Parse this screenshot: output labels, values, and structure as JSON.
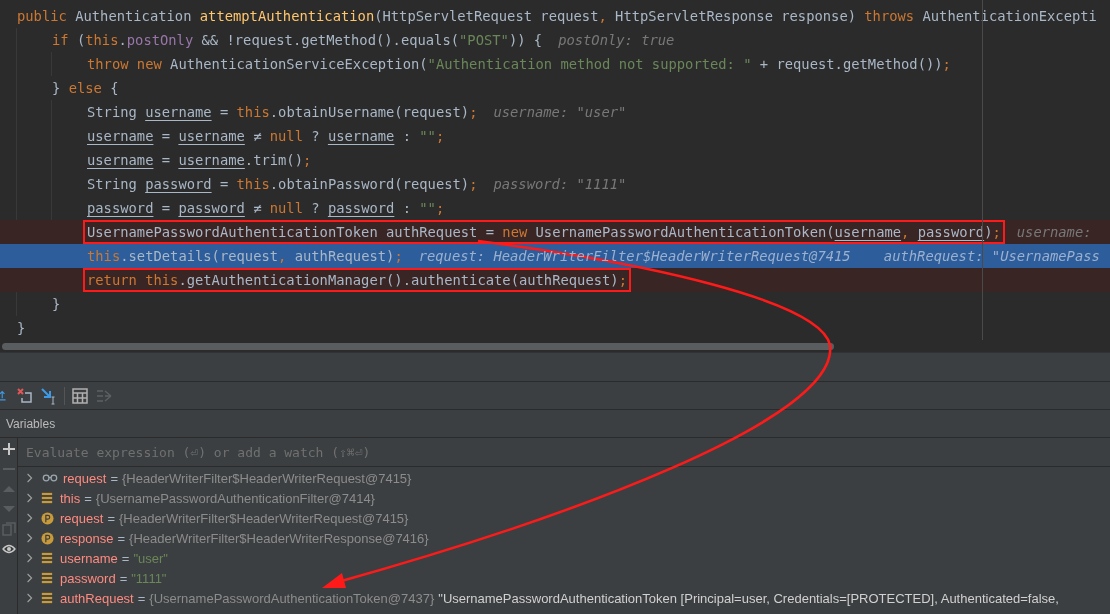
{
  "code": [
    {
      "breakpoint": false,
      "current": false,
      "tokens": [
        {
          "kind": "keyword",
          "text": "public "
        },
        {
          "kind": "text",
          "text": "Authentication "
        },
        {
          "kind": "decl",
          "text": "attemptAuthentication"
        },
        {
          "kind": "text",
          "text": "(HttpServletRequest request"
        },
        {
          "kind": "keyword",
          "text": ", "
        },
        {
          "kind": "text",
          "text": "HttpServletResponse response) "
        },
        {
          "kind": "keyword",
          "text": "throws "
        },
        {
          "kind": "text",
          "text": "AuthenticationExcepti"
        }
      ],
      "children": [
        {
          "breakpoint": false,
          "current": false,
          "tokens": [
            {
              "kind": "keyword",
              "text": "if "
            },
            {
              "kind": "text",
              "text": "("
            },
            {
              "kind": "keyword",
              "text": "this"
            },
            {
              "kind": "text",
              "text": "."
            },
            {
              "kind": "field",
              "text": "postOnly"
            },
            {
              "kind": "text",
              "text": " && !request.getMethod().equals("
            },
            {
              "kind": "string",
              "text": "\"POST\""
            },
            {
              "kind": "text",
              "text": ")) {"
            }
          ],
          "hint": "postOnly: true",
          "children": [
            {
              "breakpoint": false,
              "current": false,
              "tokens": [
                {
                  "kind": "keyword",
                  "text": "throw new "
                },
                {
                  "kind": "text",
                  "text": "AuthenticationServiceException("
                },
                {
                  "kind": "string",
                  "text": "\"Authentication method not supported: \""
                },
                {
                  "kind": "text",
                  "text": " + request.getMethod())"
                },
                {
                  "kind": "keyword",
                  "text": ";"
                }
              ]
            }
          ]
        },
        {
          "breakpoint": false,
          "current": false,
          "tokens": [
            {
              "kind": "text",
              "text": "} "
            },
            {
              "kind": "keyword",
              "text": "else "
            },
            {
              "kind": "text",
              "text": "{"
            }
          ],
          "children": [
            {
              "breakpoint": false,
              "current": false,
              "tokens": [
                {
                  "kind": "text",
                  "text": "String "
                },
                {
                  "kind": "variable",
                  "text": "username"
                },
                {
                  "kind": "text",
                  "text": " = "
                },
                {
                  "kind": "keyword",
                  "text": "this"
                },
                {
                  "kind": "text",
                  "text": ".obtainUsername(request)"
                },
                {
                  "kind": "keyword",
                  "text": ";"
                }
              ],
              "hint": "username: \"user\""
            },
            {
              "breakpoint": false,
              "current": false,
              "tokens": [
                {
                  "kind": "variable",
                  "text": "username"
                },
                {
                  "kind": "text",
                  "text": " = "
                },
                {
                  "kind": "variable",
                  "text": "username"
                },
                {
                  "kind": "text",
                  "text": " ≠ "
                },
                {
                  "kind": "keyword",
                  "text": "null"
                },
                {
                  "kind": "text",
                  "text": " ? "
                },
                {
                  "kind": "variable",
                  "text": "username"
                },
                {
                  "kind": "text",
                  "text": " : "
                },
                {
                  "kind": "string",
                  "text": "\"\""
                },
                {
                  "kind": "keyword",
                  "text": ";"
                }
              ]
            },
            {
              "breakpoint": false,
              "current": false,
              "tokens": [
                {
                  "kind": "variable",
                  "text": "username"
                },
                {
                  "kind": "text",
                  "text": " = "
                },
                {
                  "kind": "variable",
                  "text": "username"
                },
                {
                  "kind": "text",
                  "text": ".trim()"
                },
                {
                  "kind": "keyword",
                  "text": ";"
                }
              ]
            },
            {
              "breakpoint": false,
              "current": false,
              "tokens": [
                {
                  "kind": "text",
                  "text": "String "
                },
                {
                  "kind": "variable",
                  "text": "password"
                },
                {
                  "kind": "text",
                  "text": " = "
                },
                {
                  "kind": "keyword",
                  "text": "this"
                },
                {
                  "kind": "text",
                  "text": ".obtainPassword(request)"
                },
                {
                  "kind": "keyword",
                  "text": ";"
                }
              ],
              "hint": "password: \"1111\""
            },
            {
              "breakpoint": false,
              "current": false,
              "tokens": [
                {
                  "kind": "variable",
                  "text": "password"
                },
                {
                  "kind": "text",
                  "text": " = "
                },
                {
                  "kind": "variable",
                  "text": "password"
                },
                {
                  "kind": "text",
                  "text": " ≠ "
                },
                {
                  "kind": "keyword",
                  "text": "null"
                },
                {
                  "kind": "text",
                  "text": " ? "
                },
                {
                  "kind": "variable",
                  "text": "password"
                },
                {
                  "kind": "text",
                  "text": " : "
                },
                {
                  "kind": "string",
                  "text": "\"\""
                },
                {
                  "kind": "keyword",
                  "text": ";"
                }
              ]
            },
            {
              "breakpoint": true,
              "current": false,
              "boxed": true,
              "tokens": [
                {
                  "kind": "text",
                  "text": "UsernamePasswordAuthenticationToken authRequest = "
                },
                {
                  "kind": "keyword",
                  "text": "new "
                },
                {
                  "kind": "text",
                  "text": "UsernamePasswordAuthenticationToken("
                },
                {
                  "kind": "variable",
                  "text": "username"
                },
                {
                  "kind": "keyword",
                  "text": ", "
                },
                {
                  "kind": "variable",
                  "text": "password"
                },
                {
                  "kind": "text",
                  "text": ")"
                },
                {
                  "kind": "keyword",
                  "text": ";"
                }
              ],
              "hint": "username:"
            },
            {
              "breakpoint": false,
              "current": true,
              "tokens": [
                {
                  "kind": "keyword",
                  "text": "this"
                },
                {
                  "kind": "text",
                  "text": ".setDetails(request"
                },
                {
                  "kind": "keyword",
                  "text": ", "
                },
                {
                  "kind": "text",
                  "text": "authRequest)"
                },
                {
                  "kind": "keyword",
                  "text": ";"
                }
              ],
              "hint": "request: HeaderWriterFilter$HeaderWriterRequest@7415    authRequest: \"UsernamePass"
            },
            {
              "breakpoint": true,
              "current": false,
              "boxed": true,
              "tokens": [
                {
                  "kind": "keyword",
                  "text": "return this"
                },
                {
                  "kind": "text",
                  "text": ".getAuthenticationManager().authenticate(authRequest)"
                },
                {
                  "kind": "keyword",
                  "text": ";"
                }
              ]
            }
          ]
        },
        {
          "breakpoint": false,
          "current": false,
          "tokens": [
            {
              "kind": "text",
              "text": "}"
            }
          ]
        }
      ]
    },
    {
      "breakpoint": false,
      "current": false,
      "tokens": [
        {
          "kind": "text",
          "text": "}"
        }
      ]
    }
  ],
  "variables_panel": {
    "title": "Variables",
    "evaluate": {
      "placeholder": "Evaluate expression (⏎) or add a watch (⇧⌘⏎)"
    },
    "variables": [
      {
        "kind": "watch",
        "name": "request",
        "equals": "=",
        "value": {
          "kind": "object",
          "text": "{HeaderWriterFilter$HeaderWriterRequest@7415}"
        }
      },
      {
        "kind": "field",
        "name": "this",
        "equals": "=",
        "value": {
          "kind": "object",
          "text": "{UsernamePasswordAuthenticationFilter@7414}"
        }
      },
      {
        "kind": "param",
        "name": "request",
        "equals": "=",
        "value": {
          "kind": "object",
          "text": "{HeaderWriterFilter$HeaderWriterRequest@7415}"
        }
      },
      {
        "kind": "param",
        "name": "response",
        "equals": "=",
        "value": {
          "kind": "object",
          "text": "{HeaderWriterFilter$HeaderWriterResponse@7416}"
        }
      },
      {
        "kind": "field",
        "name": "username",
        "equals": "=",
        "value": {
          "kind": "string",
          "text": "\"user\""
        }
      },
      {
        "kind": "field",
        "name": "password",
        "equals": "=",
        "value": {
          "kind": "string",
          "text": "\"1111\""
        }
      },
      {
        "kind": "field",
        "name": "authRequest",
        "equals": "=",
        "value": {
          "kind": "object",
          "text": "{UsernamePasswordAuthenticationToken@7437}"
        },
        "detail": "\"UsernamePasswordAuthenticationToken [Principal=user, Credentials=[PROTECTED], Authenticated=false,"
      }
    ]
  }
}
